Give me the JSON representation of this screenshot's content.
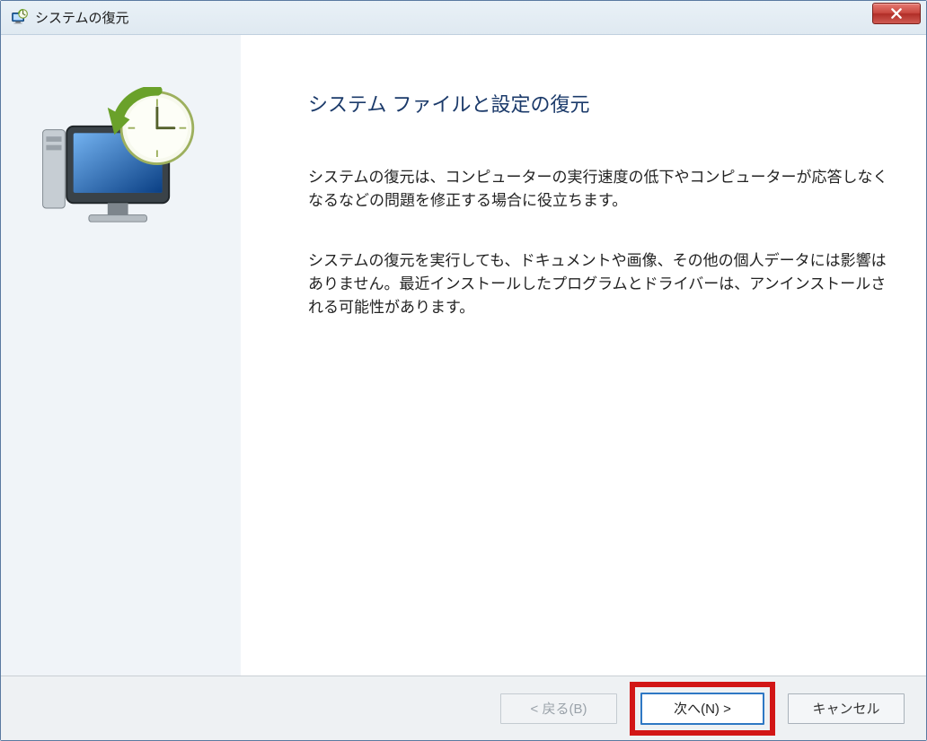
{
  "window": {
    "title": "システムの復元",
    "icon_name": "system-restore-icon"
  },
  "content": {
    "heading": "システム ファイルと設定の復元",
    "paragraph1": "システムの復元は、コンピューターの実行速度の低下やコンピューターが応答しなくなるなどの問題を修正する場合に役立ちます。",
    "paragraph2": "システムの復元を実行しても、ドキュメントや画像、その他の個人データには影響はありません。最近インストールしたプログラムとドライバーは、アンインストールされる可能性があります。"
  },
  "buttons": {
    "back": "< 戻る(B)",
    "next": "次へ(N) >",
    "cancel": "キャンセル"
  }
}
